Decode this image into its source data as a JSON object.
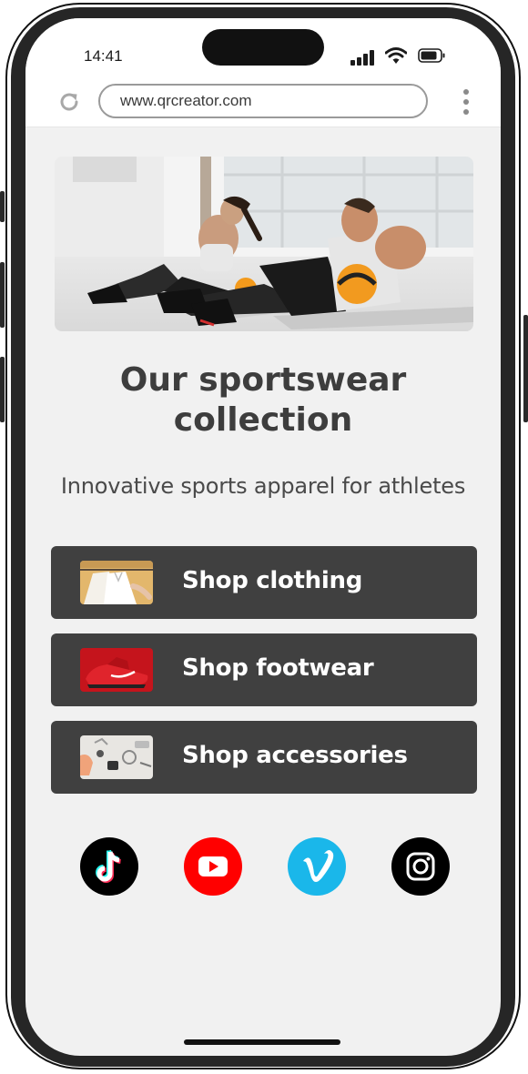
{
  "status_bar": {
    "time": "14:41",
    "signal_icon": "cellular-signal-icon",
    "wifi_icon": "wifi-icon",
    "battery_icon": "battery-icon"
  },
  "browser": {
    "reload_icon": "reload-icon",
    "url": "www.qrcreator.com",
    "menu_icon": "kebab-menu-icon"
  },
  "hero": {
    "image": "sportswear-hero-photo"
  },
  "main": {
    "title_line1": "Our sportswear",
    "title_line2": "collection",
    "subtitle": "Innovative sports apparel for athletes"
  },
  "shop_buttons": [
    {
      "label": "Shop clothing",
      "thumbnail": "clothing-thumbnail"
    },
    {
      "label": "Shop footwear",
      "thumbnail": "footwear-thumbnail"
    },
    {
      "label": "Shop accessories",
      "thumbnail": "accessories-thumbnail"
    }
  ],
  "social_links": [
    {
      "icon": "tiktok-icon",
      "color": "#000000"
    },
    {
      "icon": "youtube-icon",
      "color": "#ff0000"
    },
    {
      "icon": "vimeo-icon",
      "color": "#1ab7ea"
    },
    {
      "icon": "instagram-icon",
      "color": "#000000"
    }
  ],
  "colors": {
    "button_bg": "#404040",
    "screen_bg": "#f1f1f1",
    "text_dark": "#3d3d3d"
  }
}
